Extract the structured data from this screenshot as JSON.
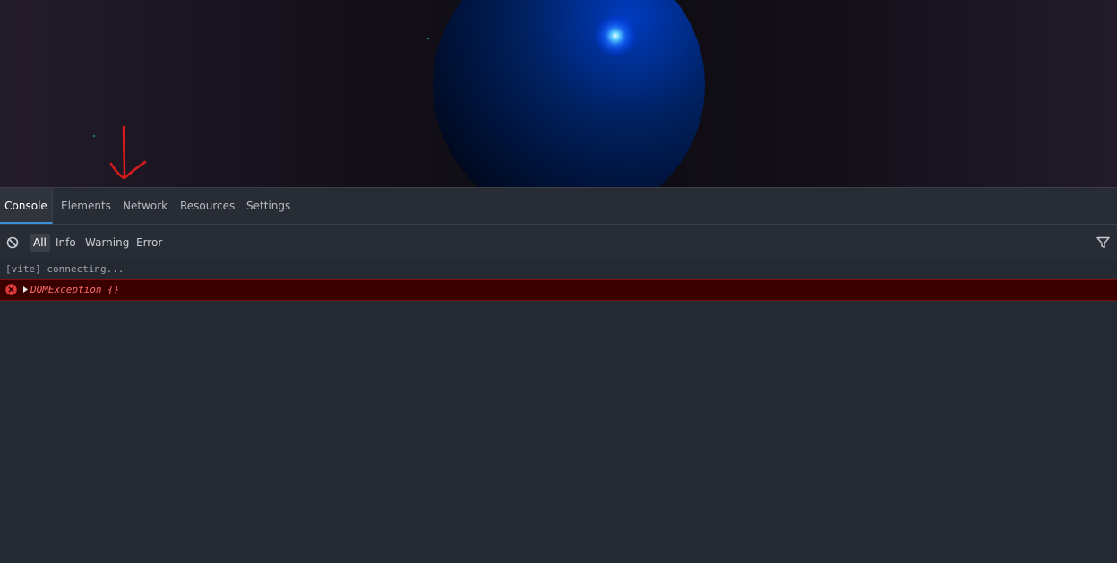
{
  "scene": {
    "sphere_color": "#002a8a",
    "glow_color": "#7fd8ff",
    "annotation_color": "#d41a1a"
  },
  "devtools": {
    "tabs": [
      {
        "label": "Console",
        "active": true
      },
      {
        "label": "Elements",
        "active": false
      },
      {
        "label": "Network",
        "active": false
      },
      {
        "label": "Resources",
        "active": false
      },
      {
        "label": "Settings",
        "active": false
      }
    ],
    "filters": [
      {
        "label": "All",
        "active": true
      },
      {
        "label": "Info",
        "active": false
      },
      {
        "label": "Warning",
        "active": false
      },
      {
        "label": "Error",
        "active": false
      }
    ],
    "logs": [
      {
        "level": "info",
        "text": "[vite] connecting..."
      },
      {
        "level": "error",
        "text": "DOMException {}"
      }
    ],
    "icons": {
      "clear": "clear-console-icon",
      "filter": "filter-funnel-icon",
      "error": "error-circle-icon",
      "expand": "expand-caret-icon"
    }
  }
}
